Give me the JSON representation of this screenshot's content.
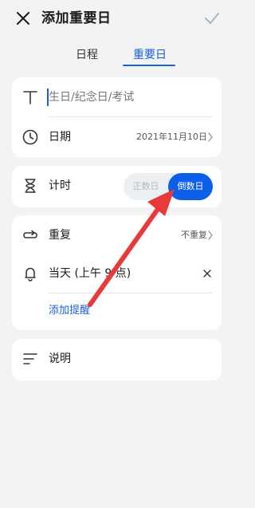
{
  "header": {
    "title": "添加重要日"
  },
  "tabs": [
    {
      "label": "日程",
      "active": false
    },
    {
      "label": "重要日",
      "active": true
    }
  ],
  "title_field": {
    "placeholder": "生日/纪念日/考试"
  },
  "date_row": {
    "label": "日期",
    "value": "2021年11月10日"
  },
  "timer_row": {
    "label": "计时",
    "options": [
      "正数日",
      "倒数日"
    ],
    "selected": "倒数日"
  },
  "repeat_row": {
    "label": "重复",
    "value": "不重复"
  },
  "reminder_row": {
    "label": "当天 (上午 9 点)"
  },
  "add_reminder": {
    "label": "添加提醒"
  },
  "notes_row": {
    "label": "说明"
  },
  "colors": {
    "accent": "#0b5fe8",
    "annotation_arrow": "#e83a3a",
    "background": "#f1f3f5"
  },
  "icons": [
    "close-icon",
    "check-icon",
    "text-icon",
    "clock-icon",
    "hourglass-icon",
    "repeat-icon",
    "bell-icon",
    "delete-x-icon",
    "notes-icon",
    "chevron-right-icon"
  ]
}
